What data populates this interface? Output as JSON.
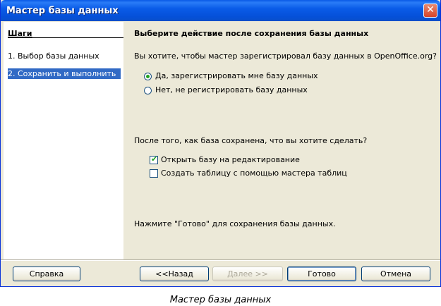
{
  "window": {
    "title": "Мастер базы данных",
    "close_glyph": "✕"
  },
  "sidebar": {
    "title": "Шаги",
    "items": [
      {
        "label": "1.  Выбор базы данных",
        "active": false
      },
      {
        "label": "2.  Сохранить и выполнить",
        "active": true
      }
    ]
  },
  "main": {
    "heading": "Выберите действие после сохранения базы данных",
    "register_question": "Вы хотите, чтобы мастер зарегистрировал базу данных в OpenOffice.org?",
    "register_options": [
      {
        "label": "Да, зарегистрировать мне базу данных",
        "selected": true
      },
      {
        "label": "Нет, не регистрировать базу данных",
        "selected": false
      }
    ],
    "after_question": "После того, как база сохранена, что вы хотите сделать?",
    "after_options": [
      {
        "label": "Открыть базу на редактирование",
        "checked": true
      },
      {
        "label": "Создать таблицу с помощью мастера таблиц",
        "checked": false
      }
    ],
    "finish_hint": "Нажмите \"Готово\" для сохранения базы данных."
  },
  "buttons": {
    "help": "Справка",
    "back": "<<Назад",
    "next": "Далее >>",
    "finish": "Готово",
    "cancel": "Отмена"
  },
  "caption": "Мастер базы данных",
  "colors": {
    "titlebar": "#0a5ae6",
    "selection": "#316ac5",
    "dialog_bg": "#ece9d8",
    "check_mark": "#21a121"
  }
}
